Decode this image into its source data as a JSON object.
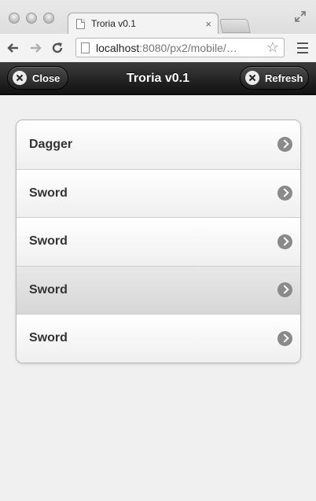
{
  "browser": {
    "tab_title": "Troria v0.1",
    "tab_close": "×",
    "url_host": "localhost",
    "url_path": ":8080/px2/mobile/…"
  },
  "header": {
    "title": "Troria v0.1",
    "close_label": "Close",
    "refresh_label": "Refresh"
  },
  "list": {
    "items": [
      {
        "label": "Dagger"
      },
      {
        "label": "Sword"
      },
      {
        "label": "Sword"
      },
      {
        "label": "Sword",
        "active": true
      },
      {
        "label": "Sword"
      }
    ]
  }
}
